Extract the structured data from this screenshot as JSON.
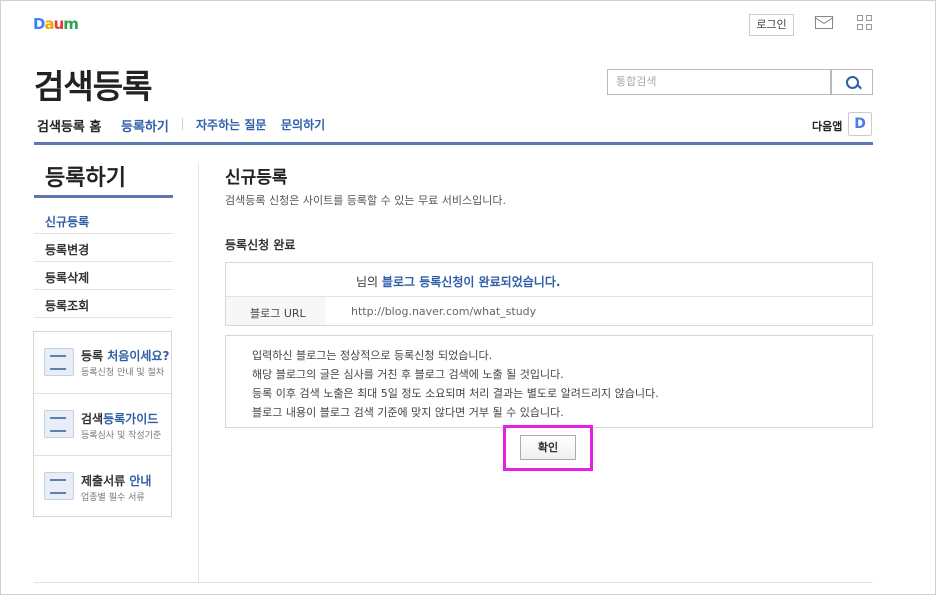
{
  "brand": {
    "logo": "Daum"
  },
  "topbar": {
    "login_label": "로그인"
  },
  "header": {
    "title": "검색등록",
    "search_placeholder": "통합검색"
  },
  "nav": {
    "home": "검색등록 홈",
    "register": "등록하기",
    "faq": "자주하는 질문",
    "contact": "문의하기",
    "daum_app": "다음앱",
    "daum_app_icon_letter": "D"
  },
  "sidebar": {
    "title": "등록하기",
    "items": [
      {
        "label": "신규등록"
      },
      {
        "label": "등록변경"
      },
      {
        "label": "등록삭제"
      },
      {
        "label": "등록조회"
      }
    ],
    "guides": [
      {
        "title_a": "등록 ",
        "title_b": "처음이세요?",
        "sub": "등록신청 안내 및 절차",
        "icon": "edit-icon"
      },
      {
        "title_a": "검색",
        "title_b": "등록가이드",
        "sub": "등록심사 및 작성기준",
        "icon": "search-guide-icon"
      },
      {
        "title_a": "제출서류 ",
        "title_b": "안내",
        "sub": "업종별 필수 서류",
        "icon": "document-icon"
      }
    ]
  },
  "content": {
    "title": "신규등록",
    "desc": "검색등록 신청은 사이트를 등록할 수 있는 무료 서비스입니다.",
    "section_title": "등록신청 완료",
    "result_prefix": "님의 ",
    "result_highlight": "블로그 등록신청이 완료되었습니다.",
    "url_label": "블로그 URL",
    "url_value": "http://blog.naver.com/what_study",
    "notices": [
      "입력하신 블로그는 정상적으로 등록신청 되었습니다.",
      "해당 블로그의 글은 심사를 거친 후 블로그 검색에 노출 될 것입니다.",
      "등록 이후 검색 노출은 최대 5일 정도 소요되며 처리 결과는 별도로 알려드리지 않습니다.",
      "블로그 내용이 블로그 검색 기준에 맞지 않다면 거부 될 수 있습니다."
    ],
    "confirm_label": "확인"
  },
  "colors": {
    "accent": "#2f5fa8",
    "rule": "#5d77b4",
    "highlight": "#e71fe0"
  }
}
